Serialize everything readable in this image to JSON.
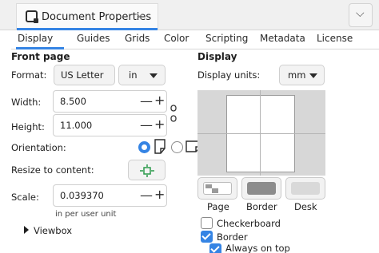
{
  "window": {
    "tab_title": "Document Properties",
    "tab_close_symbol": "×",
    "menu_symbol": "⌵"
  },
  "tabs": [
    "Display",
    "Guides",
    "Grids",
    "Color",
    "Scripting",
    "Metadata",
    "License"
  ],
  "front_page": {
    "heading": "Front page",
    "format_label": "Format:",
    "format_value": "US Letter",
    "units_value": "in",
    "width_label": "Width:",
    "width_value": "8.500",
    "height_label": "Height:",
    "height_value": "11.000",
    "orientation_label": "Orientation:",
    "resize_label": "Resize to content:",
    "scale_label": "Scale:",
    "scale_value": "0.039370",
    "scale_unit_hint": "in per user unit",
    "viewbox_label": "Viewbox",
    "minus_symbol": "—",
    "plus_symbol": "+"
  },
  "display": {
    "heading": "Display",
    "units_label": "Display units:",
    "units_value": "mm",
    "swatch_labels": [
      "Page",
      "Border",
      "Desk"
    ],
    "checkerboard_label": "Checkerboard",
    "border_label": "Border",
    "always_on_top_label": "Always on top",
    "checkerboard_checked": false,
    "border_checked": true,
    "always_on_top_checked": true
  },
  "colors": {
    "accent": "#3584e4",
    "page": "#ffffff",
    "border": "#8c8c8c",
    "desk": "#d9d9d9"
  }
}
